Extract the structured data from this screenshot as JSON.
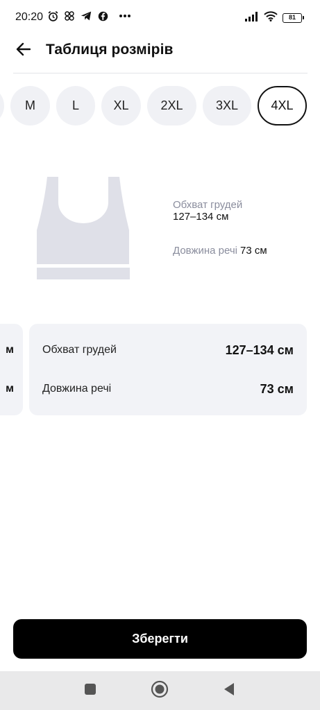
{
  "status_bar": {
    "time": "20:20",
    "battery": "81",
    "icons": [
      "alarm-icon",
      "pinwheel-icon",
      "telegram-icon",
      "facebook-icon",
      "more-dots-icon",
      "signal-icon",
      "wifi-icon",
      "battery-icon"
    ]
  },
  "header": {
    "title": "Таблиця розмірів",
    "back_icon": "arrow-left-icon"
  },
  "sizes": {
    "items": [
      "M",
      "L",
      "XL",
      "2XL",
      "3XL",
      "4XL"
    ],
    "selected": "4XL"
  },
  "illustration": {
    "chest_label": "Обхват грудей",
    "chest_value": "127–134 см",
    "length_label": "Довжина речі",
    "length_value": "73 см"
  },
  "measurements": {
    "previous_card": {
      "chest_tail": "м",
      "length_tail": "м"
    },
    "rows": [
      {
        "label": "Обхват грудей",
        "value": "127–134 см"
      },
      {
        "label": "Довжина речі",
        "value": "73 см"
      }
    ]
  },
  "actions": {
    "save_label": "Зберегти"
  },
  "nav_bar": {
    "icons": [
      "square-icon",
      "home-circle-icon",
      "back-triangle-icon"
    ]
  },
  "colors": {
    "accent": "#000000",
    "chip_bg": "#f0f1f5",
    "card_bg": "#f2f3f7",
    "muted_text": "#8a8d9d",
    "garment": "#dfe0e8"
  }
}
